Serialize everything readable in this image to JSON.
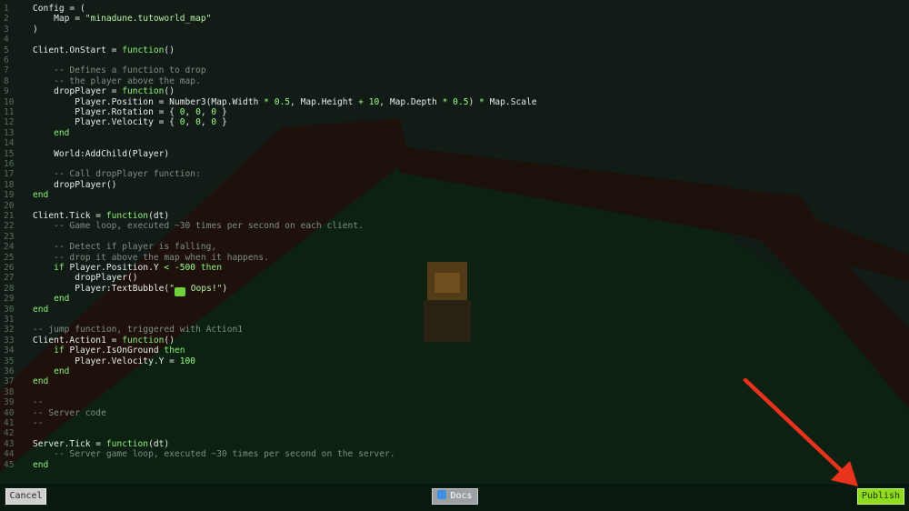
{
  "editor": {
    "lines": [
      {
        "n": "1",
        "t": [
          [
            "Config = (",
            "p"
          ]
        ]
      },
      {
        "n": "2",
        "t": [
          [
            "    Map = ",
            "p"
          ],
          [
            "\"minadune.tutoworld_map\"",
            "str"
          ]
        ]
      },
      {
        "n": "3",
        "t": [
          [
            ")",
            "p"
          ]
        ]
      },
      {
        "n": "4",
        "t": []
      },
      {
        "n": "5",
        "t": [
          [
            "Client.OnStart = ",
            "p"
          ],
          [
            "function",
            "kw"
          ],
          [
            "()",
            "p"
          ]
        ]
      },
      {
        "n": "6",
        "t": []
      },
      {
        "n": "7",
        "t": [
          [
            "    -- Defines a function to drop",
            "cm"
          ]
        ]
      },
      {
        "n": "8",
        "t": [
          [
            "    -- the player above the map.",
            "cm"
          ]
        ]
      },
      {
        "n": "9",
        "t": [
          [
            "    dropPlayer = ",
            "p"
          ],
          [
            "function",
            "kw"
          ],
          [
            "()",
            "p"
          ]
        ]
      },
      {
        "n": "10",
        "t": [
          [
            "        Player.Position = Number3(Map.Width ",
            "p"
          ],
          [
            "*",
            "op"
          ],
          [
            " ",
            "p"
          ],
          [
            "0.5",
            "num"
          ],
          [
            ", Map.Height ",
            "p"
          ],
          [
            "+",
            "op"
          ],
          [
            " ",
            "p"
          ],
          [
            "10",
            "num"
          ],
          [
            ", Map.Depth ",
            "p"
          ],
          [
            "*",
            "op"
          ],
          [
            " ",
            "p"
          ],
          [
            "0.5",
            "num"
          ],
          [
            ") ",
            "p"
          ],
          [
            "*",
            "op"
          ],
          [
            " Map.Scale",
            "p"
          ]
        ]
      },
      {
        "n": "11",
        "t": [
          [
            "        Player.Rotation = { ",
            "p"
          ],
          [
            "0",
            "num"
          ],
          [
            ", ",
            "p"
          ],
          [
            "0",
            "num"
          ],
          [
            ", ",
            "p"
          ],
          [
            "0",
            "num"
          ],
          [
            " }",
            "p"
          ]
        ]
      },
      {
        "n": "12",
        "t": [
          [
            "        Player.Velocity = { ",
            "p"
          ],
          [
            "0",
            "num"
          ],
          [
            ", ",
            "p"
          ],
          [
            "0",
            "num"
          ],
          [
            ", ",
            "p"
          ],
          [
            "0",
            "num"
          ],
          [
            " }",
            "p"
          ]
        ]
      },
      {
        "n": "13",
        "t": [
          [
            "    ",
            "p"
          ],
          [
            "end",
            "kw"
          ]
        ]
      },
      {
        "n": "14",
        "t": []
      },
      {
        "n": "15",
        "t": [
          [
            "    World:AddChild(Player)",
            "p"
          ]
        ]
      },
      {
        "n": "16",
        "t": []
      },
      {
        "n": "17",
        "t": [
          [
            "    -- Call dropPlayer function:",
            "cm"
          ]
        ]
      },
      {
        "n": "18",
        "t": [
          [
            "    dropPlayer()",
            "p"
          ]
        ]
      },
      {
        "n": "19",
        "t": [
          [
            "end",
            "kw"
          ]
        ]
      },
      {
        "n": "20",
        "t": []
      },
      {
        "n": "21",
        "t": [
          [
            "Client.Tick = ",
            "p"
          ],
          [
            "function",
            "kw"
          ],
          [
            "(dt)",
            "p"
          ]
        ]
      },
      {
        "n": "22",
        "t": [
          [
            "    -- Game loop, executed ~30 times per second on each client.",
            "cm"
          ]
        ]
      },
      {
        "n": "23",
        "t": []
      },
      {
        "n": "24",
        "t": [
          [
            "    -- Detect if player is falling,",
            "cm"
          ]
        ]
      },
      {
        "n": "25",
        "t": [
          [
            "    -- drop it above the map when it happens.",
            "cm"
          ]
        ]
      },
      {
        "n": "26",
        "t": [
          [
            "    ",
            "p"
          ],
          [
            "if",
            "kw"
          ],
          [
            " Player.Position.Y ",
            "p"
          ],
          [
            "<",
            "op"
          ],
          [
            " ",
            "p"
          ],
          [
            "-500",
            "num"
          ],
          [
            " ",
            "p"
          ],
          [
            "then",
            "kw"
          ]
        ]
      },
      {
        "n": "27",
        "t": [
          [
            "        dropPlayer()",
            "p"
          ]
        ]
      },
      {
        "n": "28",
        "t": [
          [
            "        Player:TextBubble(",
            "p"
          ],
          [
            "\"",
            "str"
          ],
          [
            "👾",
            "emoji"
          ],
          [
            " Oops!\"",
            "str"
          ],
          [
            ")",
            "p"
          ]
        ]
      },
      {
        "n": "29",
        "t": [
          [
            "    ",
            "p"
          ],
          [
            "end",
            "kw"
          ]
        ]
      },
      {
        "n": "30",
        "t": [
          [
            "end",
            "kw"
          ]
        ]
      },
      {
        "n": "31",
        "t": []
      },
      {
        "n": "32",
        "t": [
          [
            "-- jump function, triggered with Action1",
            "cm"
          ]
        ]
      },
      {
        "n": "33",
        "t": [
          [
            "Client.Action1 = ",
            "p"
          ],
          [
            "function",
            "kw"
          ],
          [
            "()",
            "p"
          ]
        ]
      },
      {
        "n": "34",
        "t": [
          [
            "    ",
            "p"
          ],
          [
            "if",
            "kw"
          ],
          [
            " Player.IsOnGround ",
            "p"
          ],
          [
            "then",
            "kw"
          ]
        ]
      },
      {
        "n": "35",
        "t": [
          [
            "        Player.Velocity.Y = ",
            "p"
          ],
          [
            "100",
            "num"
          ]
        ]
      },
      {
        "n": "36",
        "t": [
          [
            "    ",
            "p"
          ],
          [
            "end",
            "kw"
          ]
        ]
      },
      {
        "n": "37",
        "t": [
          [
            "end",
            "kw"
          ]
        ]
      },
      {
        "n": "38",
        "t": []
      },
      {
        "n": "39",
        "t": [
          [
            "--",
            "cm"
          ]
        ]
      },
      {
        "n": "40",
        "t": [
          [
            "-- Server code",
            "cm"
          ]
        ]
      },
      {
        "n": "41",
        "t": [
          [
            "--",
            "cm"
          ]
        ]
      },
      {
        "n": "42",
        "t": []
      },
      {
        "n": "43",
        "t": [
          [
            "Server.Tick = ",
            "p"
          ],
          [
            "function",
            "kw"
          ],
          [
            "(dt)",
            "p"
          ]
        ]
      },
      {
        "n": "44",
        "t": [
          [
            "    -- Server game loop, executed ~30 times per second on the server.",
            "cm"
          ]
        ]
      },
      {
        "n": "45",
        "t": [
          [
            "end",
            "kw"
          ]
        ]
      }
    ]
  },
  "toolbar": {
    "cancel_label": "Cancel",
    "docs_label": "Docs",
    "publish_label": "Publish"
  },
  "colors": {
    "publish_accent": "#8fdc1e",
    "keyword": "#8ff07a",
    "comment": "#7f8e86",
    "annotation_arrow": "#e8321c"
  },
  "icons": {
    "docs_icon": "book-icon",
    "arrow": "red-arrow-annotation"
  }
}
